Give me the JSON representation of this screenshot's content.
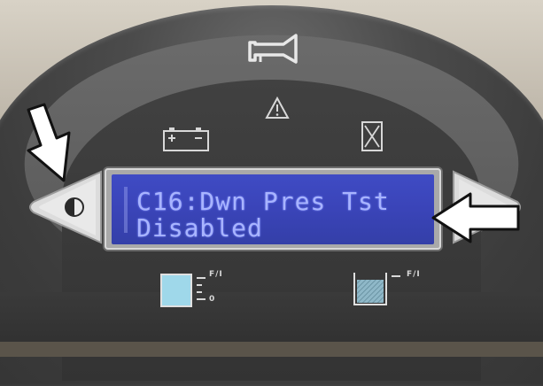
{
  "display": {
    "line1": "C16:Dwn Pres Tst",
    "line2": "Disabled"
  },
  "icons": {
    "horn": "horn-icon",
    "warning": "warning-triangle-icon",
    "battery": "battery-icon",
    "hourglass": "hourglass-icon",
    "contrast_button": "contrast-button-icon",
    "right_button": "right-arrow-button-icon"
  },
  "gauges": {
    "left_top_mark": "F/I",
    "left_bottom_mark": "0",
    "right_mark": "F/I"
  },
  "colors": {
    "lcd_background": "#3a44b8",
    "lcd_text": "#a8b4ff",
    "panel": "#3c3c3c",
    "callout_arrow": "#ffffff"
  }
}
